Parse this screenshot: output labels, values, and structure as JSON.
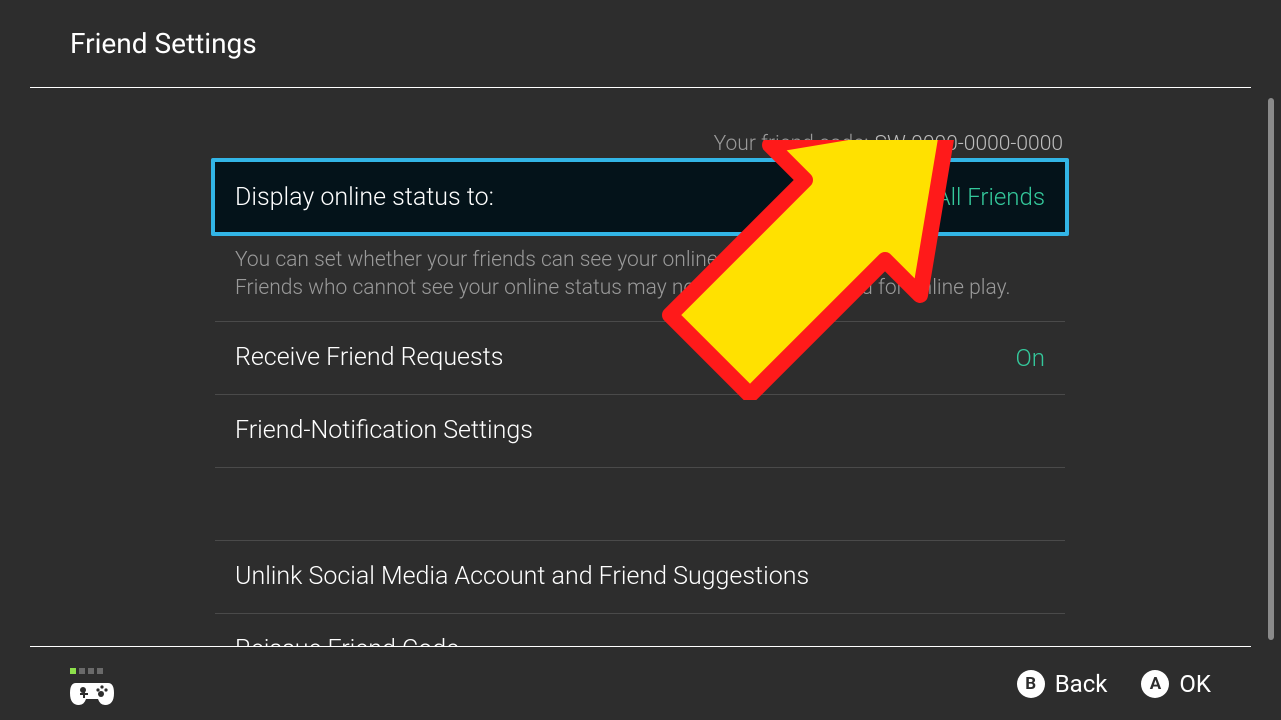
{
  "header": {
    "title": "Friend Settings"
  },
  "friend_code": {
    "label": "Your friend code:",
    "value": "SW-0000-0000-0000"
  },
  "rows": {
    "display_status": {
      "label": "Display online status to:",
      "value": "All Friends"
    },
    "display_status_desc_line1": "You can set whether your friends can see your online status.",
    "display_status_desc_line2": "Friends who cannot see your online status may not be able to join you for online play.",
    "receive_requests": {
      "label": "Receive Friend Requests",
      "value": "On"
    },
    "notification": {
      "label": "Friend-Notification Settings"
    },
    "unlink_social": {
      "label": "Unlink Social Media Account and Friend Suggestions"
    },
    "reissue": {
      "label": "Reissue Friend Code"
    }
  },
  "footer": {
    "back": {
      "glyph": "B",
      "label": "Back"
    },
    "ok": {
      "glyph": "A",
      "label": "OK"
    }
  }
}
